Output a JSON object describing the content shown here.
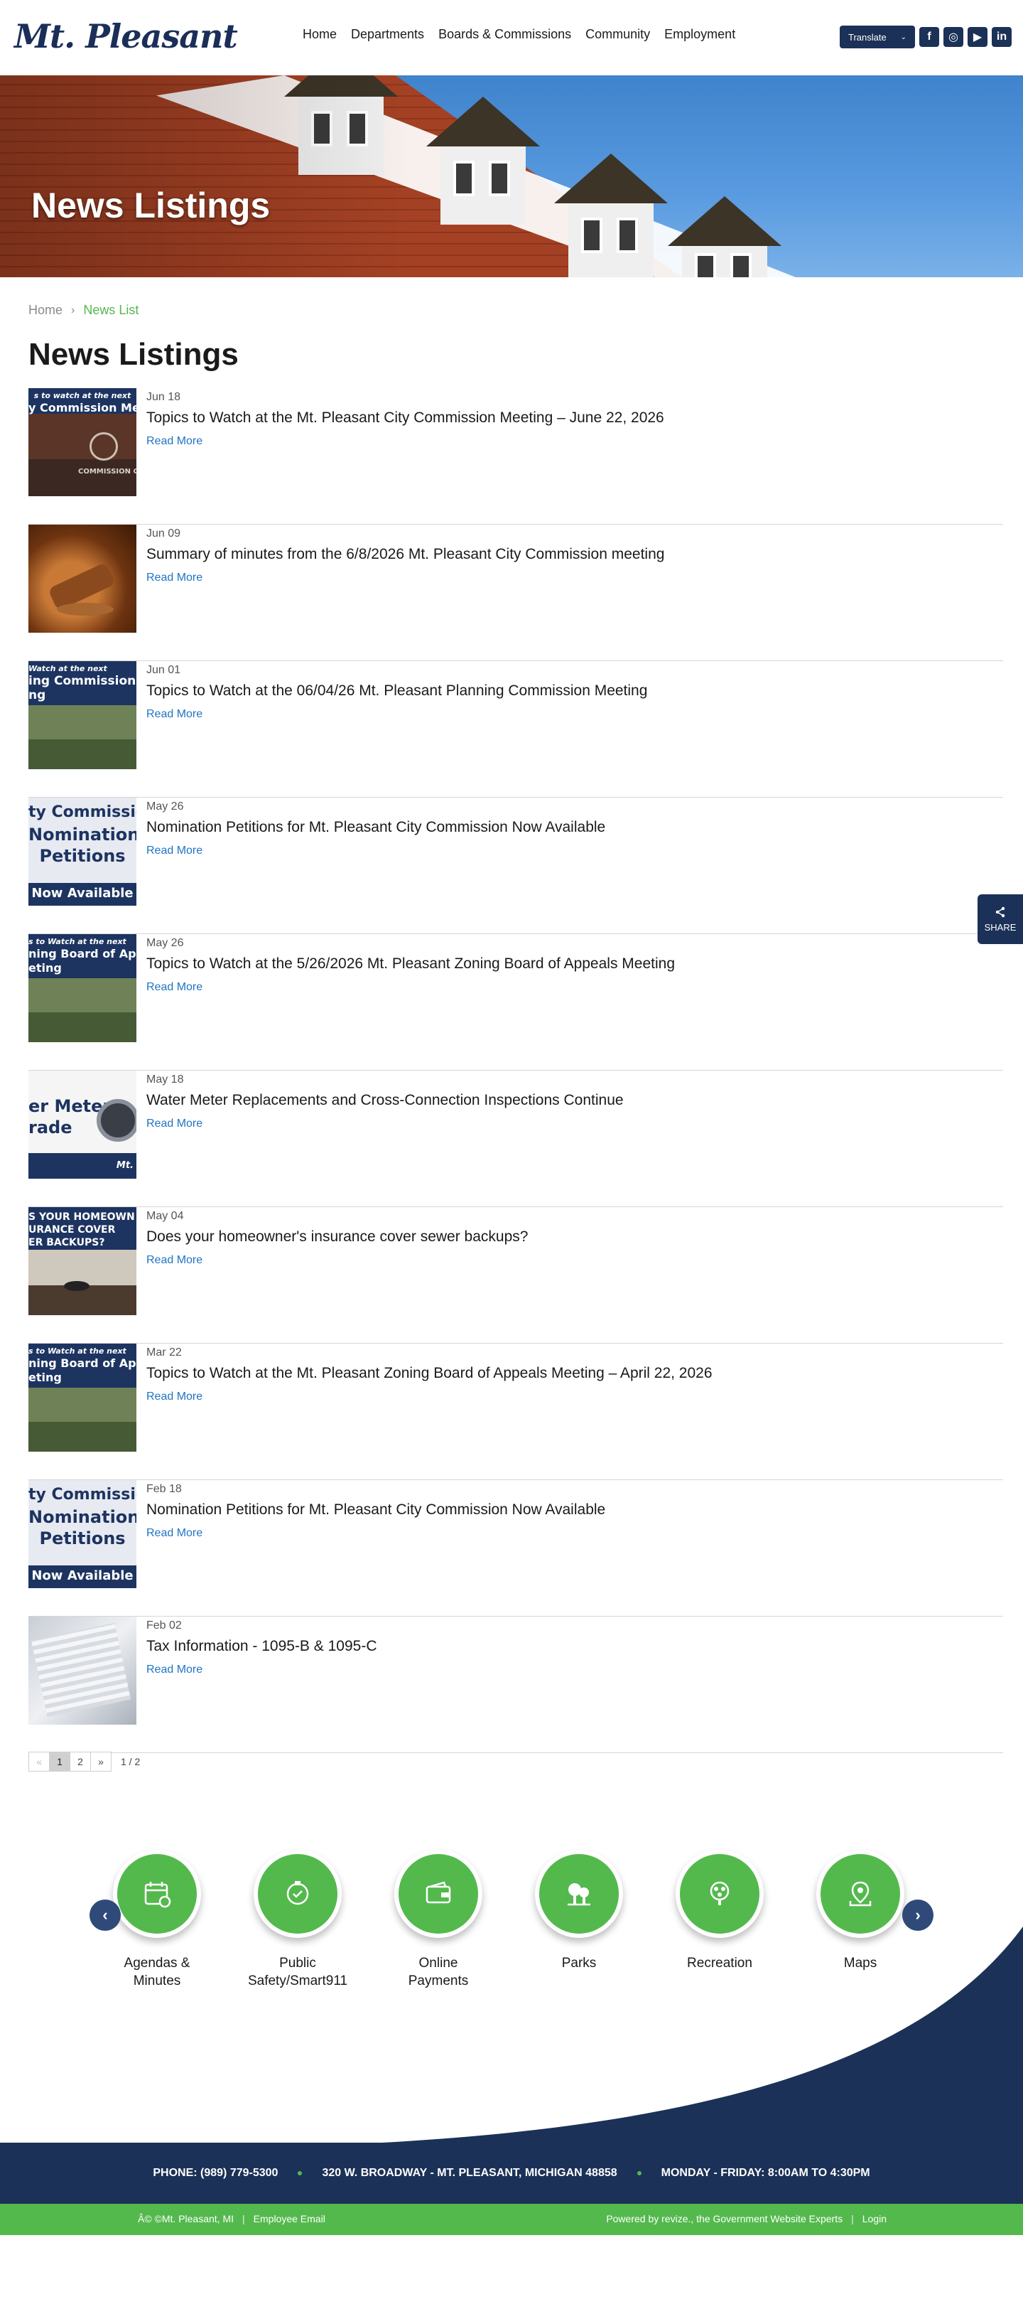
{
  "header": {
    "logo_text": "Mt. Pleasant",
    "nav": [
      "Home",
      "Departments",
      "Boards & Commissions",
      "Community",
      "Employment"
    ],
    "translate_label": "Translate",
    "social": [
      {
        "name": "facebook-icon",
        "glyph": "f"
      },
      {
        "name": "instagram-icon",
        "glyph": "◎"
      },
      {
        "name": "youtube-icon",
        "glyph": "▶"
      },
      {
        "name": "linkedin-icon",
        "glyph": "in"
      }
    ]
  },
  "hero": {
    "title": "News Listings"
  },
  "breadcrumb": {
    "home": "Home",
    "current": "News List"
  },
  "page_title": "News Listings",
  "news": [
    {
      "date": "Jun 18",
      "title": "Topics to Watch at the Mt. Pleasant City Commission Meeting – June 22, 2026",
      "more": "Read More",
      "thumb": "chamber",
      "caption_top": "s to watch at the next",
      "caption_main": "y Commission Meet",
      "caption_bottom": "COMMISSION CHAMBER"
    },
    {
      "date": "Jun 09",
      "title": "Summary of minutes from the 6/8/2026 Mt. Pleasant City Commission meeting",
      "more": "Read More",
      "thumb": "gavel",
      "caption_top": "",
      "caption_main": "",
      "caption_bottom": ""
    },
    {
      "date": "Jun 01",
      "title": "Topics to Watch at the 06/04/26 Mt. Pleasant Planning Commission Meeting",
      "more": "Read More",
      "thumb": "houses",
      "caption_top": "Watch at the next",
      "caption_main": "ing Commission",
      "caption_bottom": "ng"
    },
    {
      "date": "May 26",
      "title": "Nomination Petitions for Mt. Pleasant City Commission Now Available",
      "more": "Read More",
      "thumb": "petitions",
      "caption_top": "ty Commissio",
      "caption_main": "Nomination",
      "caption_bottom": "Petitions",
      "banner": "Now Available"
    },
    {
      "date": "May 26",
      "title": "Topics to Watch at the 5/26/2026 Mt. Pleasant Zoning Board of Appeals Meeting",
      "more": "Read More",
      "thumb": "houses",
      "caption_top": "s to Watch at the next",
      "caption_main": "ning Board of Appe",
      "caption_bottom": "eting"
    },
    {
      "date": "May 18",
      "title": "Water Meter Replacements and Cross-Connection Inspections Continue",
      "more": "Read More",
      "thumb": "meter",
      "caption_top": "er Meter",
      "caption_main": "rade",
      "caption_bottom": "Mt."
    },
    {
      "date": "May 04",
      "title": "Does your homeowner's insurance cover sewer backups?",
      "more": "Read More",
      "thumb": "insure",
      "caption_top": "S YOUR HOMEOWN",
      "caption_main": "URANCE COVER",
      "caption_bottom": "ER BACKUPS?"
    },
    {
      "date": "Mar 22",
      "title": "Topics to Watch at the Mt. Pleasant Zoning Board of Appeals Meeting – April 22, 2026",
      "more": "Read More",
      "thumb": "houses",
      "caption_top": "s to Watch at the next",
      "caption_main": "ning Board of Appe",
      "caption_bottom": "eting"
    },
    {
      "date": "Feb 18",
      "title": "Nomination Petitions for Mt. Pleasant City Commission Now Available",
      "more": "Read More",
      "thumb": "petitions",
      "caption_top": "ty Commissio",
      "caption_main": "Nomination",
      "caption_bottom": "Petitions",
      "banner": "Now Available"
    },
    {
      "date": "Feb 02",
      "title": "Tax Information - 1095-B & 1095-C",
      "more": "Read More",
      "thumb": "tax",
      "caption_top": "",
      "caption_main": "",
      "caption_bottom": ""
    }
  ],
  "pagination": {
    "prev": "«",
    "pages": [
      "1",
      "2"
    ],
    "current": "1",
    "next": "»",
    "count": "1 / 2"
  },
  "quick_links": [
    {
      "label": "Agendas & Minutes",
      "icon": "calendar-icon"
    },
    {
      "label": "Public Safety/Smart911",
      "icon": "safety-icon"
    },
    {
      "label": "Online Payments",
      "icon": "wallet-icon"
    },
    {
      "label": "Parks",
      "icon": "trees-icon"
    },
    {
      "label": "Recreation",
      "icon": "recreation-icon"
    },
    {
      "label": "Maps",
      "icon": "map-pin-icon"
    }
  ],
  "carousel": {
    "prev": "‹",
    "next": "›"
  },
  "footer": {
    "phone": "PHONE: (989) 779-5300",
    "address": "320 W. BROADWAY - MT. PLEASANT, MICHIGAN 48858",
    "hours": "MONDAY - FRIDAY: 8:00AM TO 4:30PM",
    "copyright": "Â© ©Mt. Pleasant, MI",
    "employee_email": "Employee Email",
    "powered_by": "Powered by revize., the Government Website Experts",
    "login": "Login"
  },
  "share": {
    "label": "SHARE"
  },
  "colors": {
    "navy": "#1b3157",
    "green": "#54b94d",
    "link_blue": "#1f74c3"
  }
}
